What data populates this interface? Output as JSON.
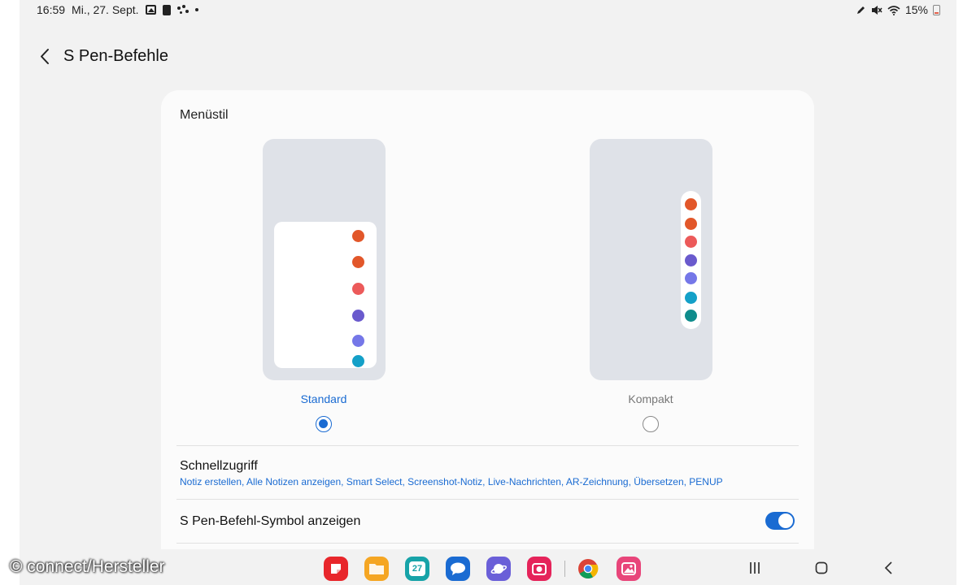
{
  "status_bar": {
    "time": "16:59",
    "date": "Mi., 27. Sept.",
    "battery": "15%",
    "left_icons": [
      "gallery-icon",
      "clipboard-icon",
      "assistant-dots-icon",
      "notification-dot-icon"
    ],
    "right_icons": [
      "pen-icon",
      "mute-icon",
      "wifi-icon",
      "battery-icon"
    ]
  },
  "header": {
    "title": "S Pen-Befehle",
    "back_icon": "chevron-left-icon"
  },
  "menu_style": {
    "label": "Menüstil",
    "options": [
      {
        "label": "Standard",
        "selected": true
      },
      {
        "label": "Kompakt",
        "selected": false
      }
    ],
    "menu_dot_colors": [
      "#e2572a",
      "#e2572a",
      "#ec5a5a",
      "#6a5acd",
      "#7577e8",
      "#14a0c8",
      "#0f8c8c"
    ]
  },
  "quick_access": {
    "title": "Schnellzugriff",
    "items": "Notiz erstellen, Alle Notizen anzeigen, Smart Select, Screenshot-Notiz, Live-Nachrichten, AR-Zeichnung, Übersetzen, PENUP"
  },
  "show_icon": {
    "title": "S Pen-Befehl-Symbol anzeigen",
    "enabled": true
  },
  "taskbar": {
    "apps": [
      {
        "name": "notes-app-icon",
        "color": "#e8262b"
      },
      {
        "name": "files-app-icon",
        "color": "#f5a623"
      },
      {
        "name": "calendar-app-icon",
        "color": "#17a3a8",
        "text": "27"
      },
      {
        "name": "messages-app-icon",
        "color": "#1a6bd2"
      },
      {
        "name": "internet-app-icon",
        "color": "#6a5fd8"
      },
      {
        "name": "camera-app-icon",
        "color": "#e5235a"
      },
      {
        "name": "chrome-app-icon",
        "color": "#4285f4"
      },
      {
        "name": "gallery-app-icon",
        "color": "#e8457a"
      }
    ]
  },
  "watermark": "© connect/Hersteller",
  "colors": {
    "accent": "#1a6bd2",
    "card": "#fbfbfb",
    "screen_bg": "#f2f2f2"
  }
}
